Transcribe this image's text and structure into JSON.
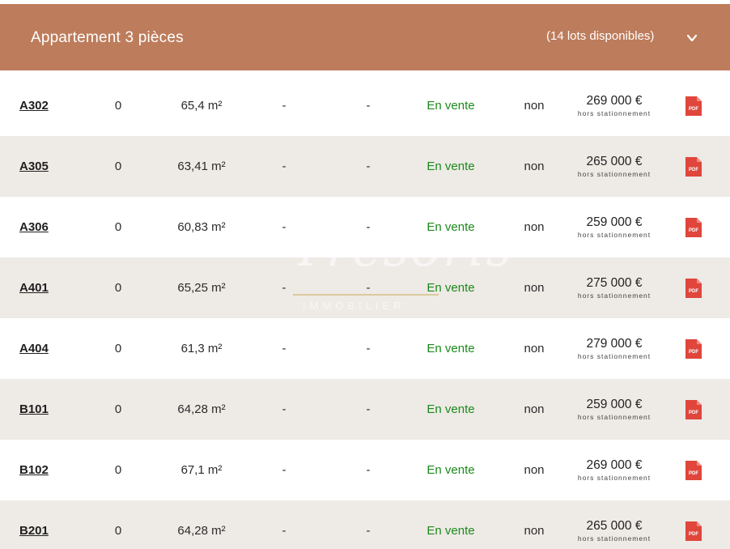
{
  "accordion": {
    "title": "Appartement 3 pièces",
    "count": "(14 lots disponibles)",
    "chevron_icon": "chevron-down-icon",
    "background_color": "#bd7c5b"
  },
  "watermark": {
    "script": "Tresoris",
    "subtitle": "IMMOBILIER"
  },
  "lots": [
    {
      "lot": "A302",
      "floor": "0",
      "surface": "65,4 m²",
      "col4": "-",
      "col5": "-",
      "status": "En vente",
      "parking": "non",
      "price": "269 000 €",
      "price_note": "hors stationnement",
      "doc_icon": "pdf-icon",
      "doc_label": "PDF"
    },
    {
      "lot": "A305",
      "floor": "0",
      "surface": "63,41 m²",
      "col4": "-",
      "col5": "-",
      "status": "En vente",
      "parking": "non",
      "price": "265 000 €",
      "price_note": "hors stationnement",
      "doc_icon": "pdf-icon",
      "doc_label": "PDF"
    },
    {
      "lot": "A306",
      "floor": "0",
      "surface": "60,83 m²",
      "col4": "-",
      "col5": "-",
      "status": "En vente",
      "parking": "non",
      "price": "259 000 €",
      "price_note": "hors stationnement",
      "doc_icon": "pdf-icon",
      "doc_label": "PDF"
    },
    {
      "lot": "A401",
      "floor": "0",
      "surface": "65,25 m²",
      "col4": "-",
      "col5": "-",
      "status": "En vente",
      "parking": "non",
      "price": "275 000 €",
      "price_note": "hors stationnement",
      "doc_icon": "pdf-icon",
      "doc_label": "PDF"
    },
    {
      "lot": "A404",
      "floor": "0",
      "surface": "61,3 m²",
      "col4": "-",
      "col5": "-",
      "status": "En vente",
      "parking": "non",
      "price": "279 000 €",
      "price_note": "hors stationnement",
      "doc_icon": "pdf-icon",
      "doc_label": "PDF"
    },
    {
      "lot": "B101",
      "floor": "0",
      "surface": "64,28 m²",
      "col4": "-",
      "col5": "-",
      "status": "En vente",
      "parking": "non",
      "price": "259 000 €",
      "price_note": "hors stationnement",
      "doc_icon": "pdf-icon",
      "doc_label": "PDF"
    },
    {
      "lot": "B102",
      "floor": "0",
      "surface": "67,1 m²",
      "col4": "-",
      "col5": "-",
      "status": "En vente",
      "parking": "non",
      "price": "269 000 €",
      "price_note": "hors stationnement",
      "doc_icon": "pdf-icon",
      "doc_label": "PDF"
    },
    {
      "lot": "B201",
      "floor": "0",
      "surface": "64,28 m²",
      "col4": "-",
      "col5": "-",
      "status": "En vente",
      "parking": "non",
      "price": "265 000 €",
      "price_note": "hors stationnement",
      "doc_icon": "pdf-icon",
      "doc_label": "PDF"
    }
  ],
  "colors": {
    "status_available": "#1a8a1a",
    "row_alt": "#eeeae6",
    "pdf_red": "#e0463b"
  }
}
